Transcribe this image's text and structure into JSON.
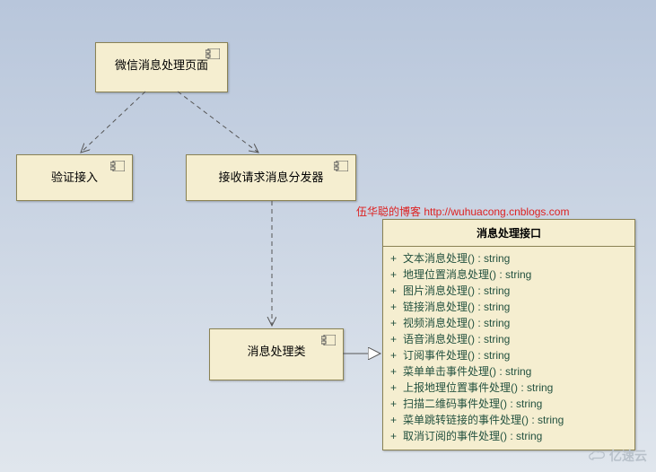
{
  "components": {
    "page": {
      "label": "微信消息处理页面"
    },
    "auth": {
      "label": "验证接入"
    },
    "dispatcher": {
      "label": "接收请求消息分发器"
    },
    "handler": {
      "label": "消息处理类"
    }
  },
  "interface": {
    "title": "消息处理接口",
    "operations": [
      {
        "name": "文本消息处理()",
        "ret": "string"
      },
      {
        "name": "地理位置消息处理()",
        "ret": "string"
      },
      {
        "name": "图片消息处理()",
        "ret": "string"
      },
      {
        "name": "链接消息处理()",
        "ret": "string"
      },
      {
        "name": "视频消息处理()",
        "ret": "string"
      },
      {
        "name": "语音消息处理()",
        "ret": "string"
      },
      {
        "name": "订阅事件处理()",
        "ret": "string"
      },
      {
        "name": "菜单单击事件处理()",
        "ret": "string"
      },
      {
        "name": "上报地理位置事件处理()",
        "ret": "string"
      },
      {
        "name": "扫描二维码事件处理()",
        "ret": "string"
      },
      {
        "name": "菜单跳转链接的事件处理()",
        "ret": "string"
      },
      {
        "name": "取消订阅的事件处理()",
        "ret": "string"
      }
    ]
  },
  "watermark": {
    "text": "伍华聪的博客 http://wuhuacong.cnblogs.com"
  },
  "logo": {
    "text": "亿速云"
  },
  "chart_data": {
    "type": "diagram",
    "diagram_kind": "UML-component/class",
    "nodes": [
      {
        "id": "page",
        "kind": "component",
        "label": "微信消息处理页面"
      },
      {
        "id": "auth",
        "kind": "component",
        "label": "验证接入"
      },
      {
        "id": "dispatcher",
        "kind": "component",
        "label": "接收请求消息分发器"
      },
      {
        "id": "handler",
        "kind": "component",
        "label": "消息处理类"
      },
      {
        "id": "iface",
        "kind": "interface",
        "label": "消息处理接口",
        "operations": [
          "文本消息处理() : string",
          "地理位置消息处理() : string",
          "图片消息处理() : string",
          "链接消息处理() : string",
          "视频消息处理() : string",
          "语音消息处理() : string",
          "订阅事件处理() : string",
          "菜单单击事件处理() : string",
          "上报地理位置事件处理() : string",
          "扫描二维码事件处理() : string",
          "菜单跳转链接的事件处理() : string",
          "取消订阅的事件处理() : string"
        ]
      }
    ],
    "edges": [
      {
        "from": "page",
        "to": "auth",
        "style": "dashed-open-arrow",
        "relation": "dependency"
      },
      {
        "from": "page",
        "to": "dispatcher",
        "style": "dashed-open-arrow",
        "relation": "dependency"
      },
      {
        "from": "dispatcher",
        "to": "handler",
        "style": "dashed-open-arrow",
        "relation": "dependency"
      },
      {
        "from": "handler",
        "to": "iface",
        "style": "solid-hollow-triangle",
        "relation": "realization"
      }
    ]
  }
}
